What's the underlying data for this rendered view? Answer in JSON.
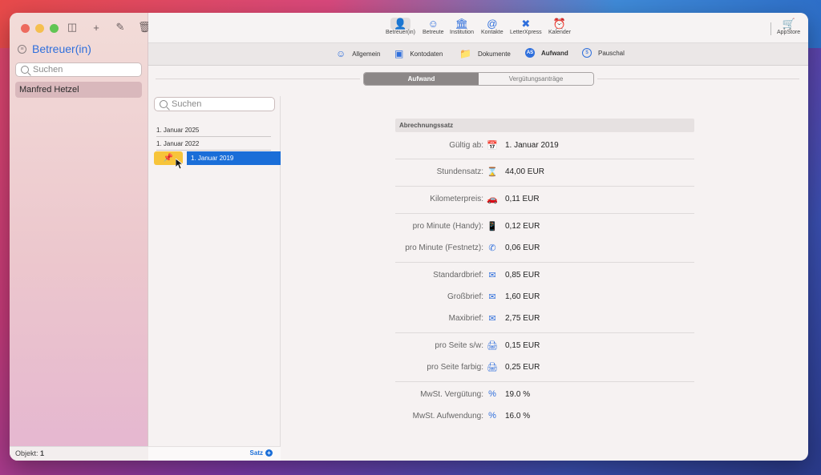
{
  "sidebar": {
    "title": "Betreuer(in)",
    "search_placeholder": "Suchen",
    "items": [
      {
        "label": "Manfred Hetzel"
      }
    ],
    "footer_label": "Objekt:",
    "footer_count": "1"
  },
  "toolbar": {
    "items": [
      {
        "label": "Betreuer(in)",
        "icon": "person-icon",
        "active": true
      },
      {
        "label": "Betreute",
        "icon": "person-outline-icon"
      },
      {
        "label": "Institution",
        "icon": "building-icon"
      },
      {
        "label": "Kontakte",
        "icon": "at-icon"
      },
      {
        "label": "LetterXpress",
        "icon": "letterxpress-icon"
      },
      {
        "label": "Kalender",
        "icon": "alarm-icon"
      }
    ],
    "appstore_label": "AppStore"
  },
  "subtabs": [
    {
      "label": "Allgemein",
      "icon": "person-icon"
    },
    {
      "label": "Kontodaten",
      "icon": "card-icon"
    },
    {
      "label": "Dokumente",
      "icon": "folder-icon"
    },
    {
      "label": "Aufwand",
      "icon": "as-badge-icon",
      "active": true
    },
    {
      "label": "Pauschal",
      "icon": "dollar-icon"
    }
  ],
  "segmented": {
    "options": [
      "Aufwand",
      "Vergütungsanträge"
    ],
    "selected": "Aufwand"
  },
  "list": {
    "search_placeholder": "Suchen",
    "rows": [
      "1. Januar 2025",
      "1. Januar 2022",
      "1. Januar 2019"
    ],
    "selected": "1. Januar 2019",
    "footer_button": "Satz"
  },
  "form": {
    "section_title": "Abrechnungssatz",
    "rows": [
      {
        "label": "Gültig ab:",
        "icon": "calendar-icon",
        "value": "1. Januar 2019"
      },
      {
        "label": "Stundensatz:",
        "icon": "hourglass-icon",
        "value": "44,00 EUR"
      },
      {
        "label": "Kilometerpreis:",
        "icon": "car-icon",
        "value": "0,11 EUR"
      },
      {
        "label": "pro Minute (Handy):",
        "icon": "phone-mobile-icon",
        "value": "0,12 EUR"
      },
      {
        "label": "pro Minute (Festnetz):",
        "icon": "phone-icon",
        "value": "0,06 EUR"
      },
      {
        "label": "Standardbrief:",
        "icon": "envelope-icon",
        "value": "0,85 EUR"
      },
      {
        "label": "Großbrief:",
        "icon": "envelope-icon",
        "value": "1,60 EUR"
      },
      {
        "label": "Maxibrief:",
        "icon": "envelope-icon",
        "value": "2,75 EUR"
      },
      {
        "label": "pro Seite s/w:",
        "icon": "printer-icon",
        "value": "0,15 EUR"
      },
      {
        "label": "pro Seite farbig:",
        "icon": "printer-icon",
        "value": "0,25 EUR"
      },
      {
        "label": "MwSt. Vergütung:",
        "icon": "percent-icon",
        "value": "19.0 %"
      },
      {
        "label": "MwSt. Aufwendung:",
        "icon": "percent-icon",
        "value": "16.0 %"
      }
    ]
  },
  "colors": {
    "accent": "#2f6fdc",
    "selection": "#1a6ed8",
    "pin": "#f7c43a"
  }
}
